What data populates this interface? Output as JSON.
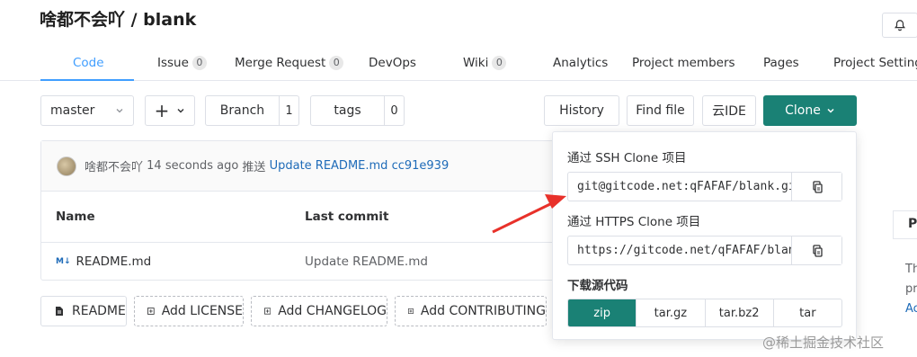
{
  "repo": {
    "title": "啥都不会吖 / blank"
  },
  "tabs": [
    {
      "label": "Code"
    },
    {
      "label": "Issue",
      "count": "0"
    },
    {
      "label": "Merge Request",
      "count": "0"
    },
    {
      "label": "DevOps"
    },
    {
      "label": "Wiki",
      "count": "0"
    },
    {
      "label": "Analytics"
    },
    {
      "label": "Project members"
    },
    {
      "label": "Pages"
    },
    {
      "label": "Project Settings"
    }
  ],
  "toolbar": {
    "branch_value": "master",
    "add_label": "+",
    "branch_label": "Branch",
    "branch_count": "1",
    "tags_label": "tags",
    "tags_count": "0",
    "history_label": "History",
    "find_file_label": "Find file",
    "ide_label": "云IDE",
    "clone_label": "Clone"
  },
  "commit": {
    "author": "啥都不会吖",
    "time": "14 seconds ago",
    "action": "推送",
    "message": "Update README.md",
    "hash": "cc91e939"
  },
  "table": {
    "headers": [
      "Name",
      "Last commit"
    ],
    "rows": [
      {
        "name": "README.md",
        "last_commit": "Update README.md"
      }
    ]
  },
  "doc_buttons": [
    "README",
    "Add LICENSE",
    "Add CHANGELOG",
    "Add CONTRIBUTING"
  ],
  "clone_menu": {
    "ssh_label": "通过 SSH Clone 项目",
    "ssh_url": "git@gitcode.net:qFAFAF/blank.git",
    "https_label": "通过 HTTPS Clone 项目",
    "https_url": "https://gitcode.net/qFAFAF/blank.git",
    "download_label": "下载源代码",
    "download_options": [
      "zip",
      "tar.gz",
      "tar.bz2",
      "tar"
    ]
  },
  "side": {
    "card_label": "P",
    "line1": "Th",
    "line2": "pr",
    "link": "Ac"
  },
  "watermark": "@稀土掘金技术社区",
  "colors": {
    "accent": "#409eff",
    "clone_green": "#1a8175",
    "arrow_red": "#e8312a"
  }
}
